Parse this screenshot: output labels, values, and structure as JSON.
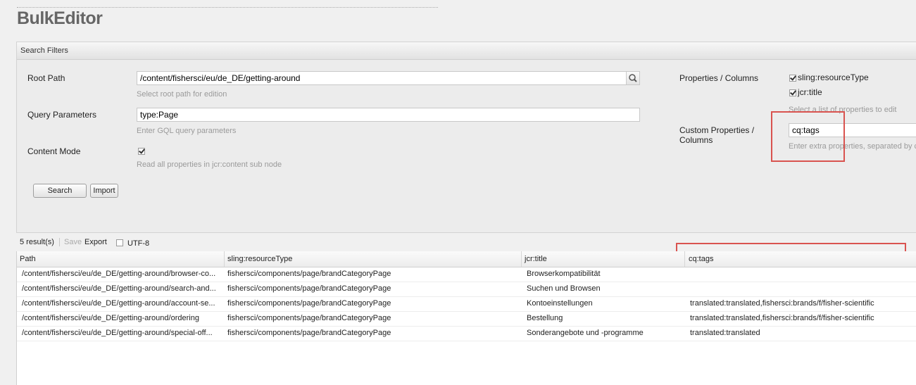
{
  "app": {
    "title": "BulkEditor"
  },
  "search_filters": {
    "header": "Search Filters",
    "root_path": {
      "label": "Root Path",
      "value": "/content/fishersci/eu/de_DE/getting-around",
      "hint": "Select root path for edition"
    },
    "query_parameters": {
      "label": "Query Parameters",
      "value": "type:Page",
      "hint": "Enter GQL query parameters"
    },
    "content_mode": {
      "label": "Content Mode",
      "checked": true,
      "hint": "Read all properties in jcr:content sub node"
    },
    "search_button": "Search",
    "import_button": "Import",
    "properties": {
      "label": "Properties / Columns",
      "options": [
        {
          "label": "sling:resourceType",
          "checked": true
        },
        {
          "label": "jcr:title",
          "checked": true
        }
      ],
      "hint": "Select a list of properties to edit"
    },
    "custom_properties": {
      "label": "Custom Properties / Columns",
      "value": "cq:tags",
      "hint": "Enter extra properties, separated by c"
    }
  },
  "results_toolbar": {
    "count": "5 result(s)",
    "save": "Save",
    "export": "Export",
    "utf8_label": "UTF-8",
    "utf8_checked": false
  },
  "grid": {
    "columns": [
      "Path",
      "sling:resourceType",
      "jcr:title",
      "cq:tags"
    ],
    "rows": [
      [
        "/content/fishersci/eu/de_DE/getting-around/browser-co...",
        "fishersci/components/page/brandCategoryPage",
        "Browserkompatibilität",
        ""
      ],
      [
        "/content/fishersci/eu/de_DE/getting-around/search-and...",
        "fishersci/components/page/brandCategoryPage",
        "Suchen und Browsen",
        ""
      ],
      [
        "/content/fishersci/eu/de_DE/getting-around/account-se...",
        "fishersci/components/page/brandCategoryPage",
        "Kontoeinstellungen",
        "translated:translated,fishersci:brands/f/fisher-scientific"
      ],
      [
        "/content/fishersci/eu/de_DE/getting-around/ordering",
        "fishersci/components/page/brandCategoryPage",
        "Bestellung",
        "translated:translated,fishersci:brands/f/fisher-scientific"
      ],
      [
        "/content/fishersci/eu/de_DE/getting-around/special-off...",
        "fishersci/components/page/brandCategoryPage",
        "Sonderangebote und -programme",
        "translated:translated"
      ]
    ]
  },
  "colors": {
    "highlight": "#d9534f"
  },
  "icons": {
    "path_trigger": "magnifier-icon"
  }
}
